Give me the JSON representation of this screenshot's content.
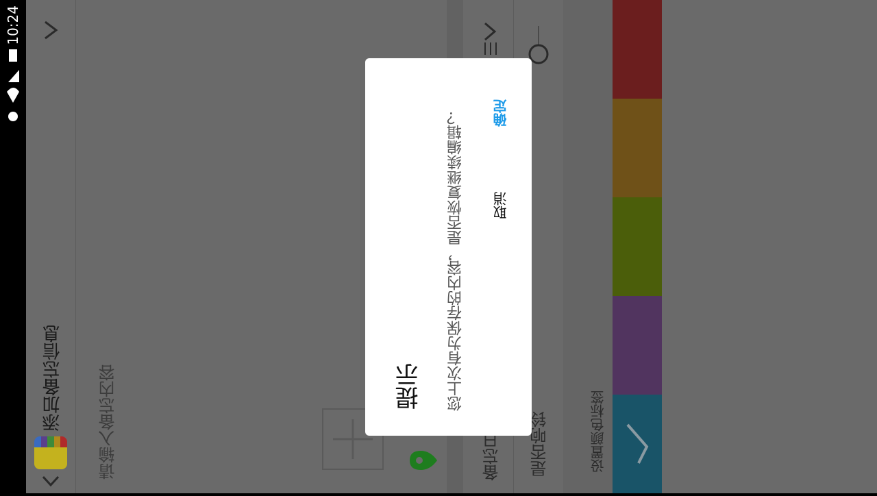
{
  "status_bar": {
    "time": "10:24"
  },
  "header": {
    "title": "添加备忘信息",
    "logo_icon": "notes-app-icon"
  },
  "content": {
    "placeholder": "请输入备忘内容"
  },
  "memo_date": {
    "label": "备忘日"
  },
  "ring": {
    "label": "是否响铃"
  },
  "color_tag": {
    "label": "设置颜色标签",
    "swatches": [
      "#6b1e1e",
      "#6f5118",
      "#4b5e0a",
      "#51345f",
      "#195468"
    ]
  },
  "dialog": {
    "title": "提示",
    "message": "您上次有为保存的内容，是否恢复继续编辑？",
    "cancel_label": "取消",
    "ok_label": "确定",
    "ok_color": "#1e9be9"
  }
}
